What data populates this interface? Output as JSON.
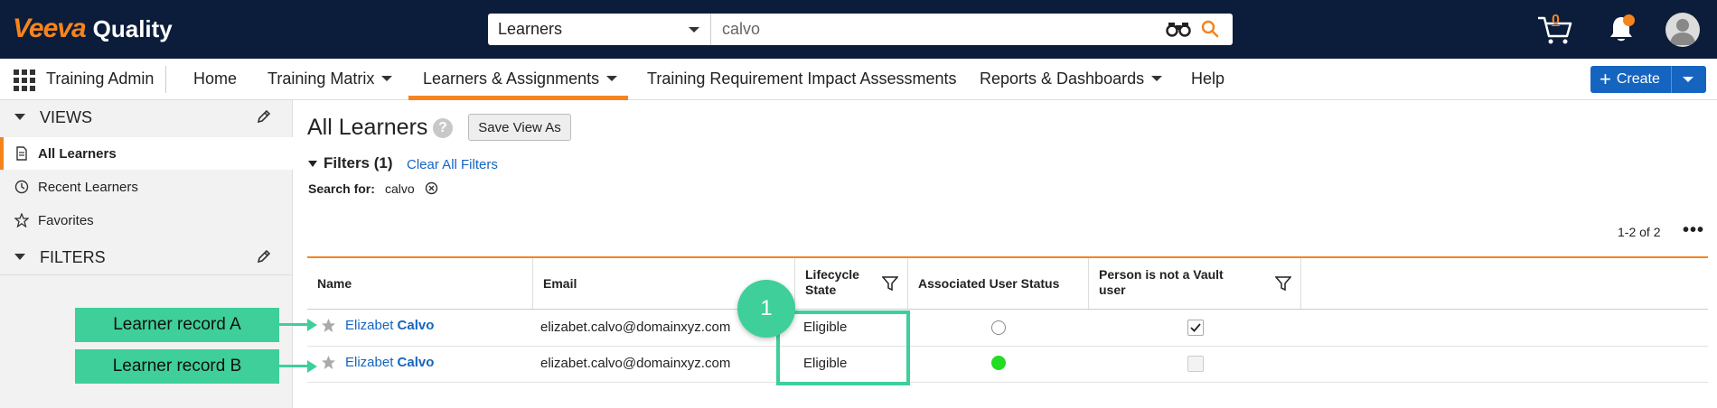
{
  "brand": {
    "name_part1": "Veeva",
    "name_part2": "Quality",
    "accent_color": "#f5841f",
    "primary_color": "#1565c0",
    "header_bg": "#0b1d3a"
  },
  "search": {
    "scope": "Learners",
    "query": "calvo"
  },
  "header": {
    "cart_count": "0"
  },
  "nav": {
    "app_name": "Training Admin",
    "items": [
      {
        "label": "Home"
      },
      {
        "label": "Training Matrix"
      },
      {
        "label": "Learners & Assignments"
      },
      {
        "label": "Training Requirement Impact Assessments"
      },
      {
        "label": "Reports & Dashboards"
      },
      {
        "label": "Help"
      }
    ],
    "active": "Learners & Assignments",
    "create_label": "Create"
  },
  "sidebar": {
    "views_title": "VIEWS",
    "views": [
      {
        "label": "All Learners",
        "icon": "document-icon"
      },
      {
        "label": "Recent Learners",
        "icon": "clock-icon"
      },
      {
        "label": "Favorites",
        "icon": "star-outline-icon"
      }
    ],
    "filters_title": "FILTERS"
  },
  "main": {
    "title": "All Learners",
    "save_view_label": "Save View As",
    "filters_label": "Filters (1)",
    "clear_filters_label": "Clear All Filters",
    "search_for_label": "Search for:",
    "search_for_value": "calvo",
    "count_text": "1-2 of 2"
  },
  "table": {
    "columns": [
      {
        "label": "Name"
      },
      {
        "label": "Email"
      },
      {
        "label": "Lifecycle State"
      },
      {
        "label": "Associated User Status"
      },
      {
        "label": "Person is not a Vault user"
      }
    ],
    "rows": [
      {
        "first": "Elizabet",
        "last": "Calvo",
        "email": "elizabet.calvo@domainxyz.com",
        "state": "Eligible",
        "user_status": "inactive",
        "not_vault_user": true
      },
      {
        "first": "Elizabet",
        "last": "Calvo",
        "email": "elizabet.calvo@domainxyz.com",
        "state": "Eligible",
        "user_status": "active",
        "not_vault_user": false
      }
    ]
  },
  "annotations": {
    "callout_a": "Learner record A",
    "callout_b": "Learner record B",
    "step": "1",
    "color": "#3ecf9a"
  }
}
